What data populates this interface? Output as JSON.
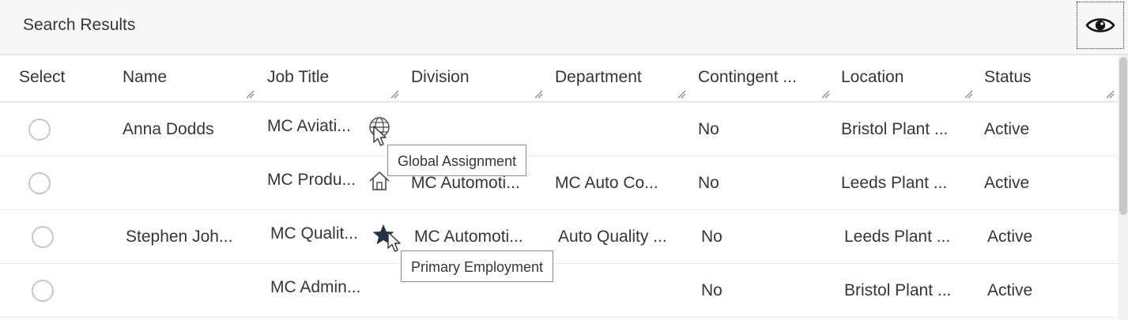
{
  "toolbar": {
    "title": "Search Results",
    "visibility_icon": "eye-icon"
  },
  "table": {
    "columns": [
      {
        "key": "select",
        "label": "Select"
      },
      {
        "key": "name",
        "label": "Name"
      },
      {
        "key": "job_title",
        "label": "Job Title"
      },
      {
        "key": "division",
        "label": "Division"
      },
      {
        "key": "department",
        "label": "Department"
      },
      {
        "key": "contingent",
        "label": "Contingent ..."
      },
      {
        "key": "location",
        "label": "Location"
      },
      {
        "key": "status",
        "label": "Status"
      }
    ],
    "rows": [
      {
        "name": "Anna Dodds",
        "job_title": "MC Aviati...",
        "job_icon": "globe-icon",
        "division": "",
        "department": "",
        "contingent": "No",
        "location": "Bristol Plant ...",
        "status": "Active"
      },
      {
        "name": "",
        "job_title": "MC Produ...",
        "job_icon": "home-icon",
        "division": "MC Automoti...",
        "department": "MC Auto Co...",
        "contingent": "No",
        "location": "Leeds Plant ...",
        "status": "Active"
      },
      {
        "name": "Stephen Joh...",
        "job_title": "MC Qualit...",
        "job_icon": "star-icon",
        "division": "MC Automoti...",
        "department": "Auto Quality ...",
        "contingent": "No",
        "location": "Leeds Plant ...",
        "status": "Active"
      },
      {
        "name": "",
        "job_title": "MC Admin...",
        "job_icon": "",
        "division": "",
        "department": "",
        "contingent": "No",
        "location": "Bristol Plant ...",
        "status": "Active"
      }
    ]
  },
  "tooltips": {
    "global_assignment": "Global Assignment",
    "primary_employment": "Primary Employment"
  },
  "colors": {
    "text": "#32363a",
    "toolbar_bg": "#f7f7f7",
    "radio_border": "#c7c7c7",
    "star": "#223548"
  }
}
